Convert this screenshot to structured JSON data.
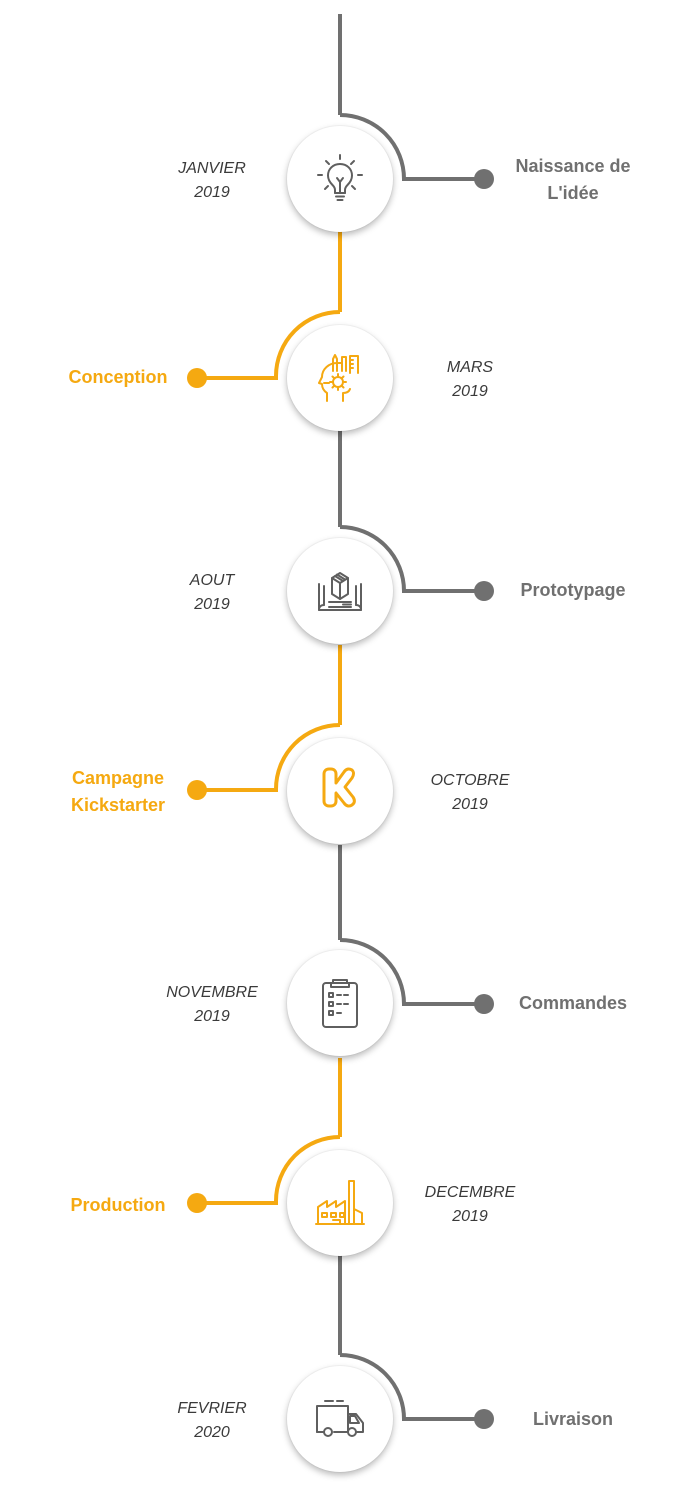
{
  "colors": {
    "gray_line": "#707070",
    "accent": "#F5A911",
    "node_background": "#FFFFFF",
    "date_text": "#3A3A3A"
  },
  "milestones": [
    {
      "side": "right",
      "color": "gray",
      "date_line1": "JANVIER",
      "date_line2": "2019",
      "label_line1": "Naissance de",
      "label_line2": "L'idée",
      "icon": "lightbulb-icon"
    },
    {
      "side": "left",
      "color": "orange",
      "date_line1": "MARS",
      "date_line2": "2019",
      "label_line1": "Conception",
      "label_line2": "",
      "icon": "design-head-icon"
    },
    {
      "side": "right",
      "color": "gray",
      "date_line1": "AOUT",
      "date_line2": "2019",
      "label_line1": "Prototypage",
      "label_line2": "",
      "icon": "prototype-blueprint-icon"
    },
    {
      "side": "left",
      "color": "orange",
      "date_line1": "OCTOBRE",
      "date_line2": "2019",
      "label_line1": "Campagne",
      "label_line2": "Kickstarter",
      "icon": "kickstarter-icon"
    },
    {
      "side": "right",
      "color": "gray",
      "date_line1": "NOVEMBRE",
      "date_line2": "2019",
      "label_line1": "Commandes",
      "label_line2": "",
      "icon": "clipboard-icon"
    },
    {
      "side": "left",
      "color": "orange",
      "date_line1": "DECEMBRE",
      "date_line2": "2019",
      "label_line1": "Production",
      "label_line2": "",
      "icon": "factory-icon"
    },
    {
      "side": "right",
      "color": "gray",
      "date_line1": "FEVRIER",
      "date_line2": "2020",
      "label_line1": "Livraison",
      "label_line2": "",
      "icon": "delivery-truck-icon"
    }
  ]
}
